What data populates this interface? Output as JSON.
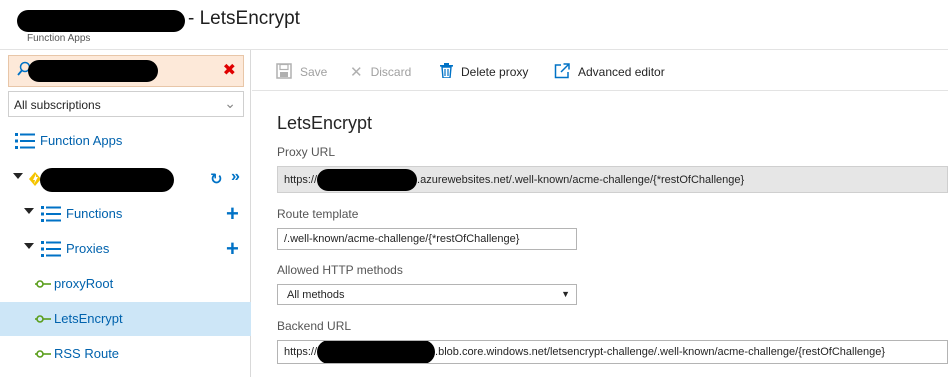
{
  "header": {
    "title": "- LetsEncrypt",
    "subtitle": "Function Apps"
  },
  "sidebar": {
    "search": {
      "value": ""
    },
    "subscriptions": {
      "selected": "All subscriptions"
    },
    "items": [
      {
        "label": "Function Apps",
        "icon": "list-icon"
      },
      {
        "label": "",
        "icon": "function-app-icon"
      },
      {
        "label": "Functions",
        "icon": "list-icon"
      },
      {
        "label": "Proxies",
        "icon": "list-icon"
      },
      {
        "label": "proxyRoot",
        "icon": "proxy-icon"
      },
      {
        "label": "LetsEncrypt",
        "icon": "proxy-icon",
        "selected": true
      },
      {
        "label": "RSS Route",
        "icon": "proxy-icon"
      }
    ]
  },
  "toolbar": {
    "save_label": "Save",
    "discard_label": "Discard",
    "delete_label": "Delete proxy",
    "editor_label": "Advanced editor"
  },
  "form": {
    "heading": "LetsEncrypt",
    "proxy_url_label": "Proxy URL",
    "proxy_url_prefix": "https://",
    "proxy_url_suffix": ".azurewebsites.net/.well-known/acme-challenge/{*restOfChallenge}",
    "route_label": "Route template",
    "route_value": "/.well-known/acme-challenge/{*restOfChallenge}",
    "methods_label": "Allowed HTTP methods",
    "methods_value": "All methods",
    "backend_label": "Backend URL",
    "backend_prefix": "https://",
    "backend_suffix": ".blob.core.windows.net/letsencrypt-challenge/.well-known/acme-challenge/{restOfChallenge}"
  },
  "colors": {
    "accent": "#0072c6",
    "link": "#0062ad",
    "selected_bg": "#cde6f7",
    "search_bg": "#fde9d9",
    "proxy_icon": "#5a9e1c",
    "error_red": "#e00000"
  }
}
